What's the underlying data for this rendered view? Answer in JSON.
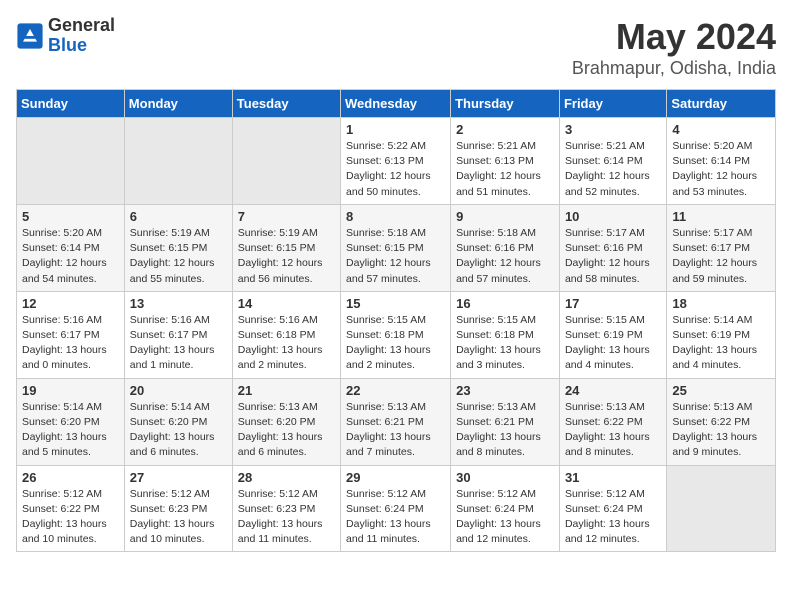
{
  "logo": {
    "general": "General",
    "blue": "Blue"
  },
  "header": {
    "month": "May 2024",
    "location": "Brahmapur, Odisha, India"
  },
  "weekdays": [
    "Sunday",
    "Monday",
    "Tuesday",
    "Wednesday",
    "Thursday",
    "Friday",
    "Saturday"
  ],
  "weeks": [
    [
      {
        "day": "",
        "info": ""
      },
      {
        "day": "",
        "info": ""
      },
      {
        "day": "",
        "info": ""
      },
      {
        "day": "1",
        "info": "Sunrise: 5:22 AM\nSunset: 6:13 PM\nDaylight: 12 hours\nand 50 minutes."
      },
      {
        "day": "2",
        "info": "Sunrise: 5:21 AM\nSunset: 6:13 PM\nDaylight: 12 hours\nand 51 minutes."
      },
      {
        "day": "3",
        "info": "Sunrise: 5:21 AM\nSunset: 6:14 PM\nDaylight: 12 hours\nand 52 minutes."
      },
      {
        "day": "4",
        "info": "Sunrise: 5:20 AM\nSunset: 6:14 PM\nDaylight: 12 hours\nand 53 minutes."
      }
    ],
    [
      {
        "day": "5",
        "info": "Sunrise: 5:20 AM\nSunset: 6:14 PM\nDaylight: 12 hours\nand 54 minutes."
      },
      {
        "day": "6",
        "info": "Sunrise: 5:19 AM\nSunset: 6:15 PM\nDaylight: 12 hours\nand 55 minutes."
      },
      {
        "day": "7",
        "info": "Sunrise: 5:19 AM\nSunset: 6:15 PM\nDaylight: 12 hours\nand 56 minutes."
      },
      {
        "day": "8",
        "info": "Sunrise: 5:18 AM\nSunset: 6:15 PM\nDaylight: 12 hours\nand 57 minutes."
      },
      {
        "day": "9",
        "info": "Sunrise: 5:18 AM\nSunset: 6:16 PM\nDaylight: 12 hours\nand 57 minutes."
      },
      {
        "day": "10",
        "info": "Sunrise: 5:17 AM\nSunset: 6:16 PM\nDaylight: 12 hours\nand 58 minutes."
      },
      {
        "day": "11",
        "info": "Sunrise: 5:17 AM\nSunset: 6:17 PM\nDaylight: 12 hours\nand 59 minutes."
      }
    ],
    [
      {
        "day": "12",
        "info": "Sunrise: 5:16 AM\nSunset: 6:17 PM\nDaylight: 13 hours\nand 0 minutes."
      },
      {
        "day": "13",
        "info": "Sunrise: 5:16 AM\nSunset: 6:17 PM\nDaylight: 13 hours\nand 1 minute."
      },
      {
        "day": "14",
        "info": "Sunrise: 5:16 AM\nSunset: 6:18 PM\nDaylight: 13 hours\nand 2 minutes."
      },
      {
        "day": "15",
        "info": "Sunrise: 5:15 AM\nSunset: 6:18 PM\nDaylight: 13 hours\nand 2 minutes."
      },
      {
        "day": "16",
        "info": "Sunrise: 5:15 AM\nSunset: 6:18 PM\nDaylight: 13 hours\nand 3 minutes."
      },
      {
        "day": "17",
        "info": "Sunrise: 5:15 AM\nSunset: 6:19 PM\nDaylight: 13 hours\nand 4 minutes."
      },
      {
        "day": "18",
        "info": "Sunrise: 5:14 AM\nSunset: 6:19 PM\nDaylight: 13 hours\nand 4 minutes."
      }
    ],
    [
      {
        "day": "19",
        "info": "Sunrise: 5:14 AM\nSunset: 6:20 PM\nDaylight: 13 hours\nand 5 minutes."
      },
      {
        "day": "20",
        "info": "Sunrise: 5:14 AM\nSunset: 6:20 PM\nDaylight: 13 hours\nand 6 minutes."
      },
      {
        "day": "21",
        "info": "Sunrise: 5:13 AM\nSunset: 6:20 PM\nDaylight: 13 hours\nand 6 minutes."
      },
      {
        "day": "22",
        "info": "Sunrise: 5:13 AM\nSunset: 6:21 PM\nDaylight: 13 hours\nand 7 minutes."
      },
      {
        "day": "23",
        "info": "Sunrise: 5:13 AM\nSunset: 6:21 PM\nDaylight: 13 hours\nand 8 minutes."
      },
      {
        "day": "24",
        "info": "Sunrise: 5:13 AM\nSunset: 6:22 PM\nDaylight: 13 hours\nand 8 minutes."
      },
      {
        "day": "25",
        "info": "Sunrise: 5:13 AM\nSunset: 6:22 PM\nDaylight: 13 hours\nand 9 minutes."
      }
    ],
    [
      {
        "day": "26",
        "info": "Sunrise: 5:12 AM\nSunset: 6:22 PM\nDaylight: 13 hours\nand 10 minutes."
      },
      {
        "day": "27",
        "info": "Sunrise: 5:12 AM\nSunset: 6:23 PM\nDaylight: 13 hours\nand 10 minutes."
      },
      {
        "day": "28",
        "info": "Sunrise: 5:12 AM\nSunset: 6:23 PM\nDaylight: 13 hours\nand 11 minutes."
      },
      {
        "day": "29",
        "info": "Sunrise: 5:12 AM\nSunset: 6:24 PM\nDaylight: 13 hours\nand 11 minutes."
      },
      {
        "day": "30",
        "info": "Sunrise: 5:12 AM\nSunset: 6:24 PM\nDaylight: 13 hours\nand 12 minutes."
      },
      {
        "day": "31",
        "info": "Sunrise: 5:12 AM\nSunset: 6:24 PM\nDaylight: 13 hours\nand 12 minutes."
      },
      {
        "day": "",
        "info": ""
      }
    ]
  ]
}
